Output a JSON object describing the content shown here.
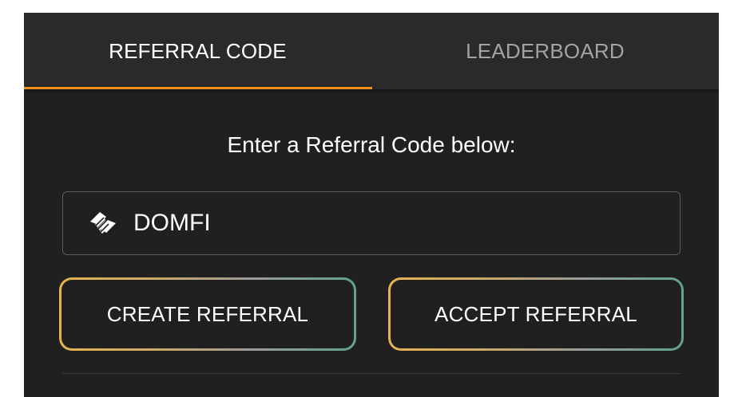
{
  "tabs": [
    {
      "label": "REFERRAL CODE",
      "active": true
    },
    {
      "label": "LEADERBOARD",
      "active": false
    }
  ],
  "prompt": "Enter a Referral Code below:",
  "referral_input": {
    "value": "DOMFI",
    "icon": "handshake-icon"
  },
  "buttons": {
    "create_label": "CREATE REFERRAL",
    "accept_label": "ACCEPT REFERRAL"
  },
  "colors": {
    "accent": "#f0901c",
    "panel_bg": "#202020",
    "tab_bar_bg": "#2a2a2a",
    "button_border_gradient": [
      "#e6b34e",
      "#9b9b9b",
      "#5fa192"
    ]
  }
}
